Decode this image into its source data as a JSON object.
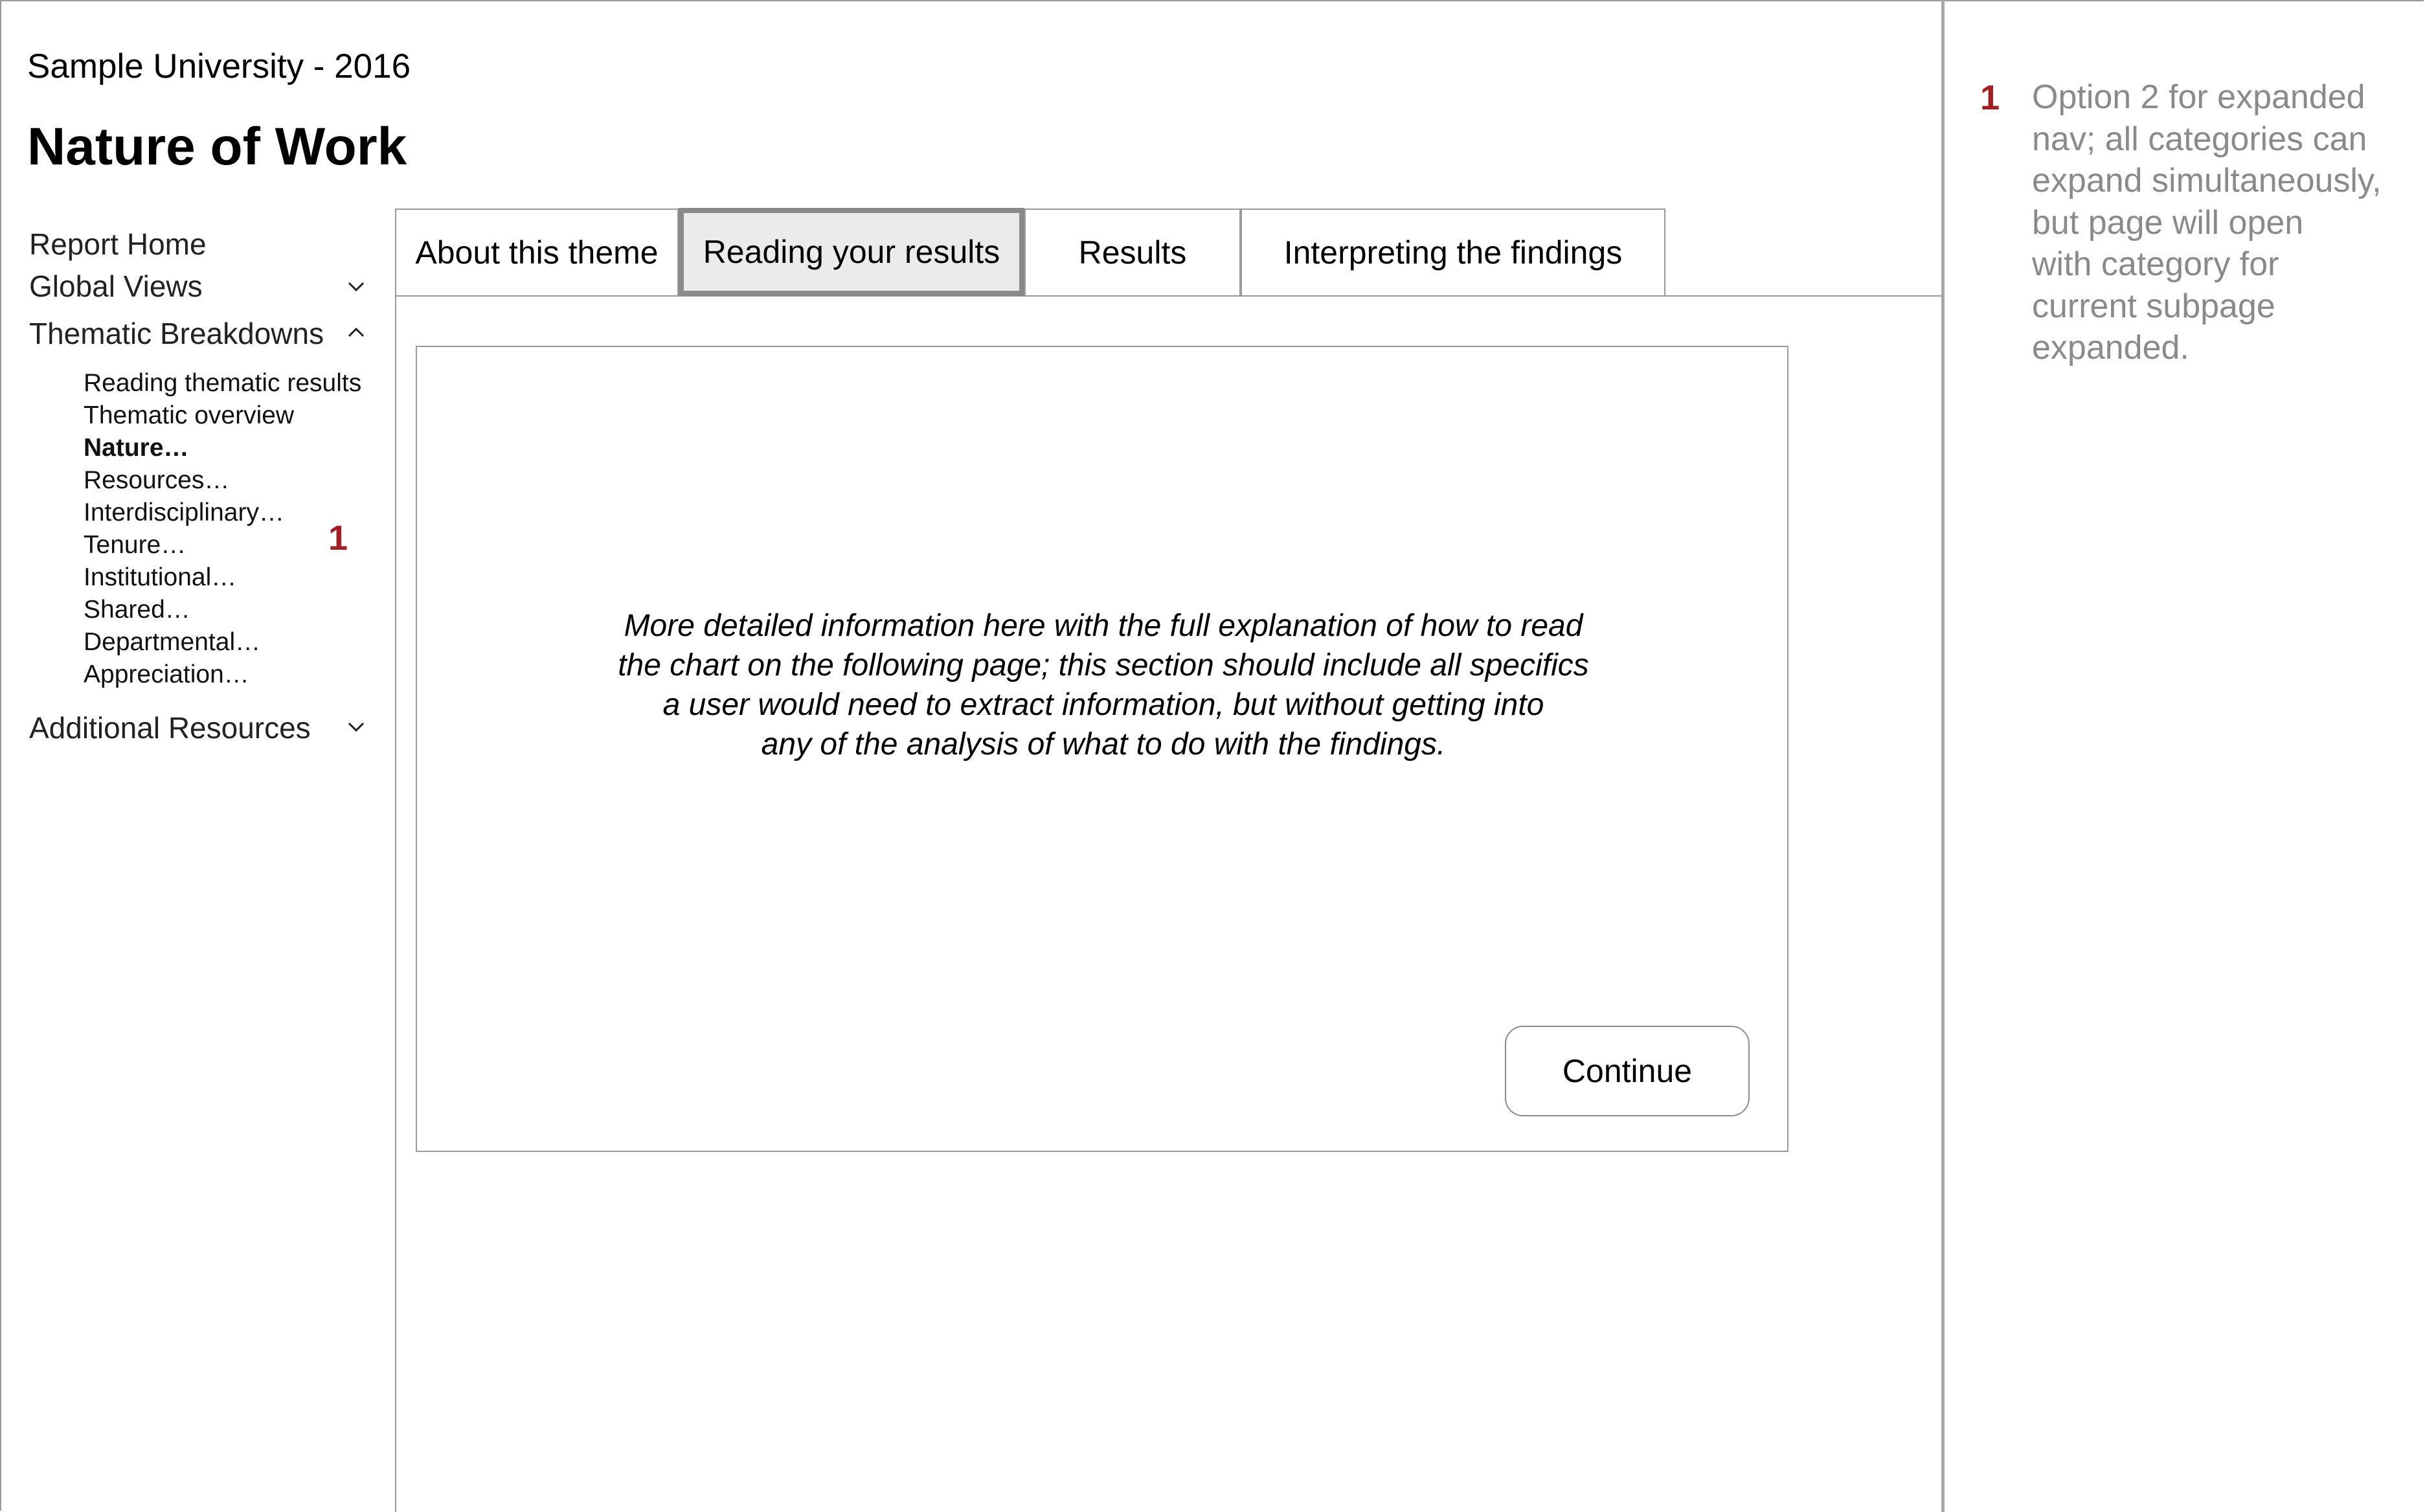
{
  "header": {
    "app_title": "Sample University - 2016",
    "page_title": "Nature of Work"
  },
  "sidebar": {
    "items": [
      {
        "label": "Report Home"
      },
      {
        "label": "Global Views",
        "icon": "chevron-down-icon"
      },
      {
        "label": "Thematic Breakdowns",
        "icon": "chevron-up-icon",
        "expanded": true
      },
      {
        "label": "Additional Resources",
        "icon": "chevron-down-icon"
      }
    ],
    "subitems": [
      {
        "label": "Reading thematic results"
      },
      {
        "label": "Thematic overview"
      },
      {
        "label": "Nature…",
        "active": true
      },
      {
        "label": "Resources…"
      },
      {
        "label": "Interdisciplinary…"
      },
      {
        "label": "Tenure…"
      },
      {
        "label": "Institutional…"
      },
      {
        "label": "Shared…"
      },
      {
        "label": "Departmental…"
      },
      {
        "label": "Appreciation…"
      }
    ],
    "marker": "1"
  },
  "tabs": [
    {
      "label": "About this theme"
    },
    {
      "label": "Reading your results",
      "active": true
    },
    {
      "label": "Results"
    },
    {
      "label": "Interpreting the findings"
    }
  ],
  "panel": {
    "lines": [
      "More detailed information here with the full explanation of how to read",
      "the chart on the following page; this section should include all specifics",
      "a user would need to extract information, but without getting into",
      "any of the analysis of what to do with the findings."
    ],
    "continue_label": "Continue"
  },
  "annotation": {
    "number": "1",
    "lines": [
      "Option 2 for expanded",
      "nav; all categories can",
      "expand simultaneously,",
      "but page will open",
      "with category for",
      "current subpage",
      "expanded."
    ]
  },
  "colors": {
    "marker_red": "#a31f24",
    "annotation_gray": "#8a8a8a",
    "active_tab_bg": "#ebebeb",
    "border_gray": "#9a9a9a"
  }
}
